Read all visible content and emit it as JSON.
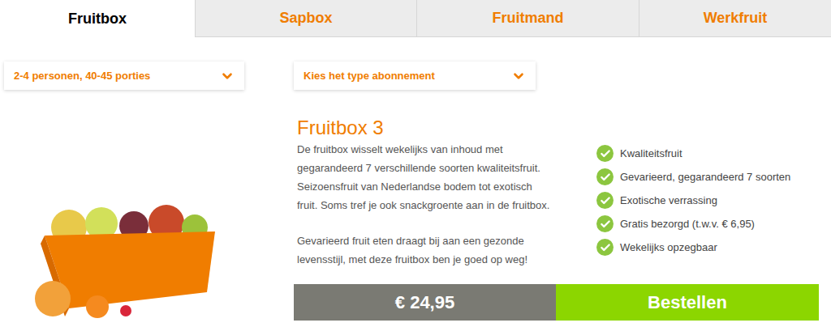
{
  "tabs": [
    {
      "label": "Fruitbox",
      "selected": true
    },
    {
      "label": "Sapbox",
      "selected": false
    },
    {
      "label": "Fruitmand",
      "selected": false
    },
    {
      "label": "Werkfruit",
      "selected": false
    }
  ],
  "filters": [
    {
      "label": "2-4 personen, 40-45 porties"
    },
    {
      "label": "Kies het type abonnement"
    }
  ],
  "product": {
    "title": "Fruitbox 3",
    "description": [
      [
        "De fruitbox wisselt wekelijks van inhoud met",
        "gegarandeerd 7 verschillende soorten kwaliteitsfruit.",
        "Seizoensfruit van Nederlandse bodem tot exotisch",
        "fruit. Soms tref je ook snackgroente aan in de fruitbox."
      ],
      [
        "Gevarieerd fruit eten draagt bij aan een gezonde",
        "levensstijl, met deze fruitbox ben je goed op weg!"
      ]
    ],
    "features": [
      {
        "label": "Kwaliteitsfruit",
        "checked": true
      },
      {
        "label": "Gevarieerd, gegarandeerd 7 soorten",
        "checked": true
      },
      {
        "label": "Exotische verrassing",
        "checked": true
      },
      {
        "label": "Gratis bezorgd (t.w.v. € 6,95)",
        "checked": true
      },
      {
        "label": "Wekelijks opzegbaar",
        "checked": true
      }
    ],
    "price": "€ 24,95",
    "order_button": "Bestellen"
  }
}
